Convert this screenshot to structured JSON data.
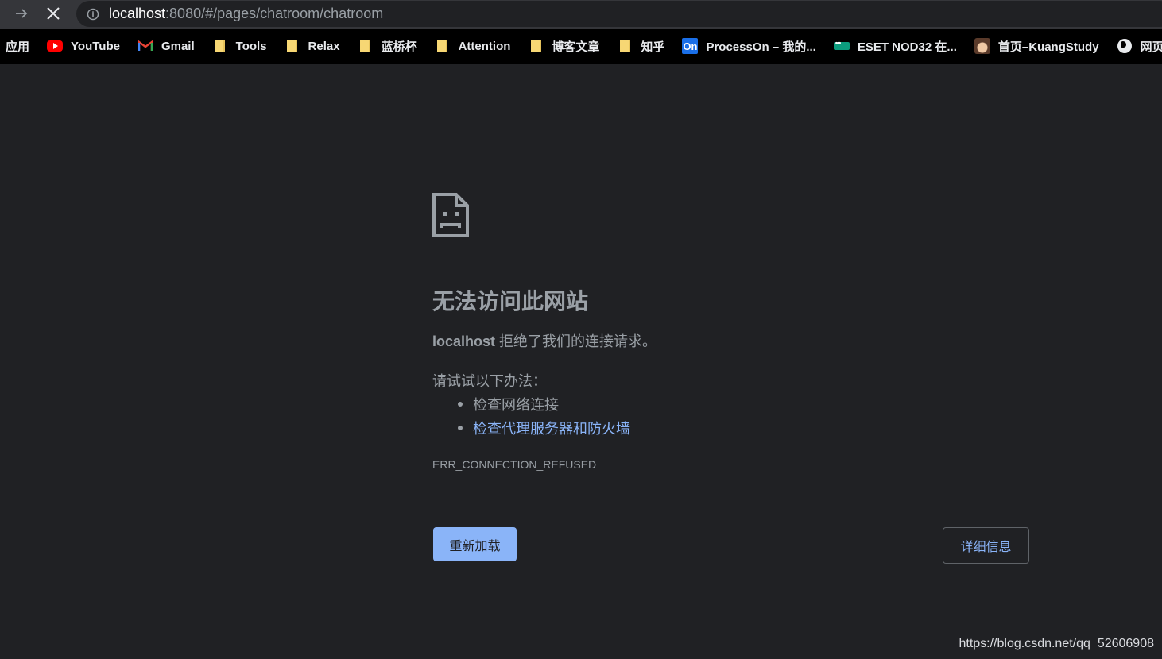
{
  "browser": {
    "url_host": "localhost",
    "url_rest": ":8080/#/pages/chatroom/chatroom"
  },
  "bookmarks": {
    "items": [
      {
        "label": "应用",
        "icon": "none"
      },
      {
        "label": "YouTube",
        "icon": "youtube-icon"
      },
      {
        "label": "Gmail",
        "icon": "gmail-icon"
      },
      {
        "label": "Tools",
        "icon": "folder-icon"
      },
      {
        "label": "Relax",
        "icon": "folder-icon"
      },
      {
        "label": "蓝桥杯",
        "icon": "folder-icon"
      },
      {
        "label": "Attention",
        "icon": "folder-icon"
      },
      {
        "label": "博客文章",
        "icon": "folder-icon"
      },
      {
        "label": "知乎",
        "icon": "folder-icon"
      },
      {
        "label": "ProcessOn – 我的...",
        "icon": "processon-icon",
        "icon_text": "On"
      },
      {
        "label": "ESET NOD32 在...",
        "icon": "eset-icon"
      },
      {
        "label": "首页–KuangStudy",
        "icon": "avatar-icon"
      },
      {
        "label": "网页转",
        "icon": "globe-icon"
      }
    ]
  },
  "error": {
    "title": "无法访问此网站",
    "host": "localhost",
    "message": " 拒绝了我们的连接请求。",
    "try_label": "请试试以下办法：",
    "suggestions": [
      "检查网络连接",
      "检查代理服务器和防火墙"
    ],
    "code": "ERR_CONNECTION_REFUSED",
    "reload_label": "重新加载",
    "details_label": "详细信息"
  },
  "watermark": "https://blog.csdn.net/qq_52606908",
  "colors": {
    "background": "#202124",
    "link": "#8ab4f8",
    "text": "#9aa0a6"
  }
}
